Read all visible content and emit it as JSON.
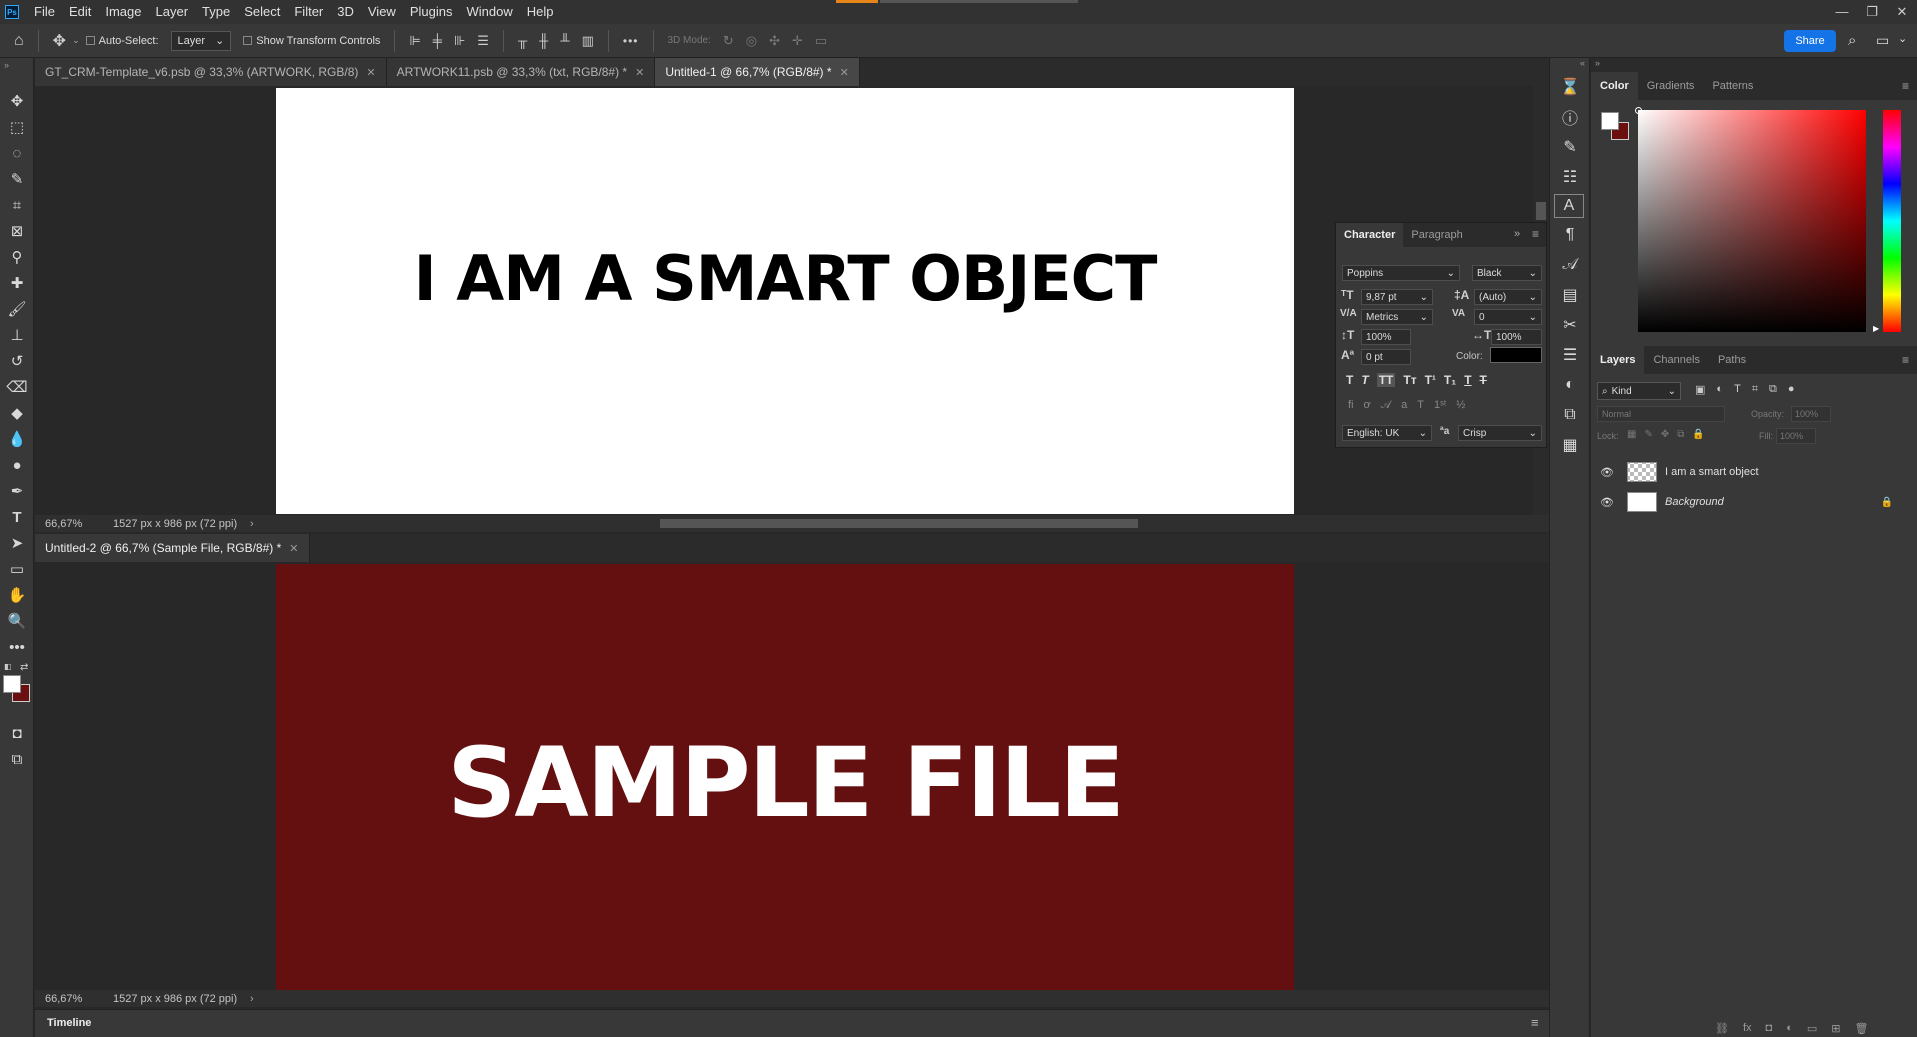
{
  "app": {
    "logo": "Ps",
    "menu": [
      "File",
      "Edit",
      "Image",
      "Layer",
      "Type",
      "Select",
      "Filter",
      "3D",
      "View",
      "Plugins",
      "Window",
      "Help"
    ]
  },
  "options": {
    "auto_select_label": "Auto-Select:",
    "layer_select": "Layer",
    "show_transform_label": "Show Transform Controls",
    "mode_3d_label": "3D Mode:",
    "more_label": "•••",
    "share_label": "Share"
  },
  "tabs": [
    {
      "label": "GT_CRM-Template_v6.psb @ 33,3% (ARTWORK, RGB/8)",
      "active": false
    },
    {
      "label": "ARTWORK11.psb @ 33,3% (txt, RGB/8#) *",
      "active": false
    },
    {
      "label": "Untitled-1 @ 66,7% (RGB/8#) *",
      "active": true
    }
  ],
  "doc1": {
    "text": "I AM A SMART OBJECT",
    "zoom": "66,67%",
    "dims": "1527 px x 986 px (72 ppi)",
    "bg_color": "#ffffff"
  },
  "doc2": {
    "tab_label": "Untitled-2 @ 66,7% (Sample File, RGB/8#) *",
    "text": "SAMPLE FILE",
    "zoom": "66,67%",
    "dims": "1527 px x 986 px (72 ppi)",
    "bg_color": "#641010"
  },
  "timeline": {
    "label": "Timeline"
  },
  "character": {
    "tab_character": "Character",
    "tab_paragraph": "Paragraph",
    "font_family": "Poppins",
    "font_style": "Black",
    "size": "9,87 pt",
    "leading": "(Auto)",
    "kerning": "Metrics",
    "tracking": "0",
    "v_scale": "100%",
    "h_scale": "100%",
    "baseline": "0 pt",
    "color_label": "Color:",
    "language": "English: UK",
    "antialias": "Crisp",
    "aa_icon": "ªa"
  },
  "color_panel": {
    "tabs": [
      "Color",
      "Gradients",
      "Patterns"
    ],
    "fg": "#ffffff",
    "bg": "#6b1010",
    "hue": "#ff0000"
  },
  "layers_panel": {
    "tabs": [
      "Layers",
      "Channels",
      "Paths"
    ],
    "kind": "Kind",
    "blend": "Normal",
    "opacity_label": "Opacity:",
    "opacity": "100%",
    "lock_label": "Lock:",
    "fill_label": "Fill:",
    "fill": "100%",
    "layers": [
      {
        "name": "I am a smart object",
        "italic": false
      },
      {
        "name": "Background",
        "italic": true
      }
    ]
  }
}
